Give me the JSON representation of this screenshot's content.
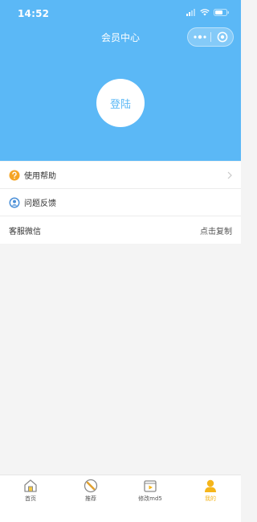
{
  "status_bar": {
    "time": "14:52"
  },
  "nav": {
    "title": "会员中心"
  },
  "profile": {
    "login_label": "登陆"
  },
  "menu": {
    "items": [
      {
        "label": "使用帮助",
        "icon": "help-icon"
      },
      {
        "label": "问题反馈",
        "icon": "feedback-user-icon"
      },
      {
        "label": "客服微信",
        "value": "点击复制"
      }
    ]
  },
  "tabbar": {
    "tabs": [
      {
        "label": "首页",
        "icon": "home-icon"
      },
      {
        "label": "推荐",
        "icon": "recommend-icon"
      },
      {
        "label": "修改md5",
        "icon": "video-icon"
      },
      {
        "label": "我的",
        "icon": "user-icon",
        "active": true
      }
    ]
  },
  "colors": {
    "header_blue": "#5bb8f6",
    "active_tab": "#f5b51a",
    "help_orange": "#f5a524",
    "feedback_blue": "#4a8fd8"
  }
}
